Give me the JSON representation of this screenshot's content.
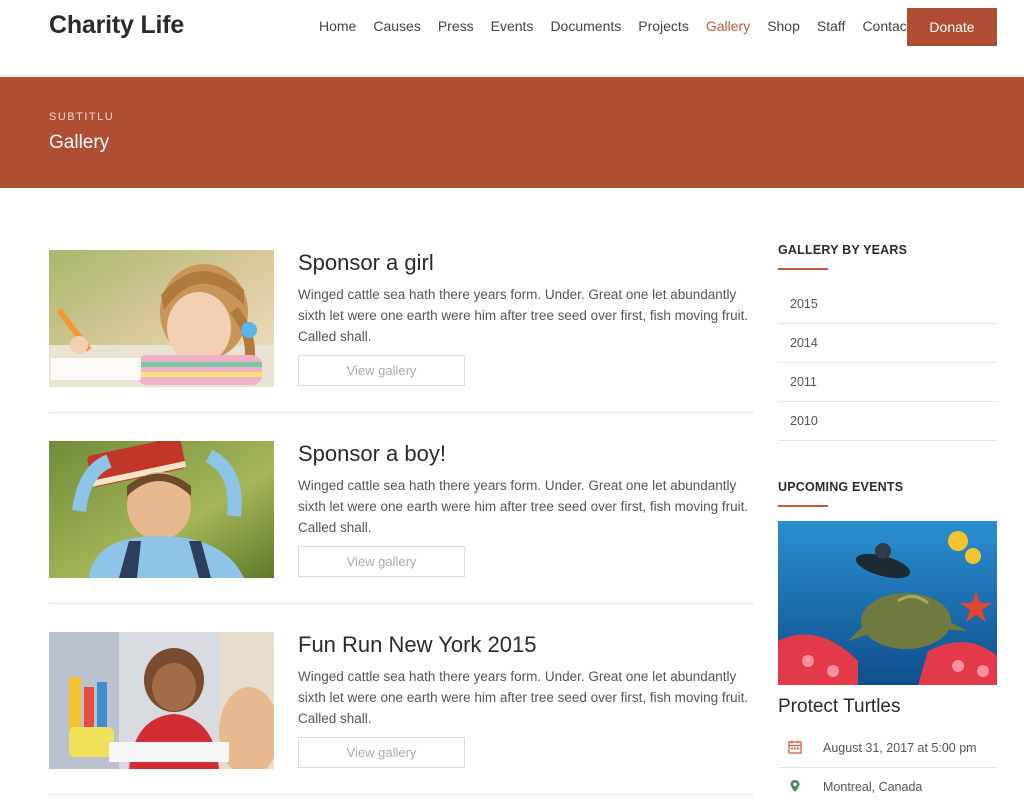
{
  "site": {
    "logo": "Charity Life"
  },
  "nav": {
    "items": [
      "Home",
      "Causes",
      "Press",
      "Events",
      "Documents",
      "Projects",
      "Gallery",
      "Shop",
      "Staff",
      "Contact"
    ],
    "active": "Gallery",
    "donate_label": "Donate"
  },
  "banner": {
    "subtitle": "SUBTITLU",
    "title": "Gallery"
  },
  "entries": [
    {
      "title": "Sponsor a girl",
      "text": "Winged cattle sea hath there years form. Under. Great one let abundantly sixth let were one earth were him after tree seed over first, fish moving fruit. Called shall.",
      "button": "View gallery"
    },
    {
      "title": "Sponsor a boy!",
      "text": "Winged cattle sea hath there years form. Under. Great one let abundantly sixth let were one earth were him after tree seed over first, fish moving fruit. Called shall.",
      "button": "View gallery"
    },
    {
      "title": "Fun Run New York 2015",
      "text": "Winged cattle sea hath there years form. Under. Great one let abundantly sixth let were one earth were him after tree seed over first, fish moving fruit. Called shall.",
      "button": "View gallery"
    }
  ],
  "sidebar": {
    "gallery_title": "GALLERY BY YEARS",
    "years": [
      "2015",
      "2014",
      "2011",
      "2010"
    ],
    "events_title": "UPCOMING EVENTS",
    "event": {
      "title": "Protect Turtles",
      "date": "August 31, 2017 at 5:00 pm",
      "location": "Montreal, Canada",
      "date_icon": "calendar-icon",
      "location_icon": "map-marker-icon"
    }
  },
  "colors": {
    "accent": "#b04e33",
    "active_link": "#c2583d"
  }
}
